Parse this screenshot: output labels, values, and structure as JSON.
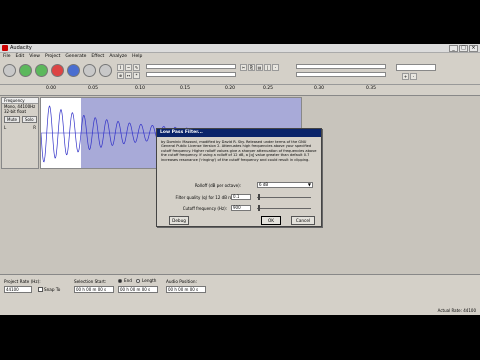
{
  "window": {
    "title": "Audacity"
  },
  "menu": [
    "File",
    "Edit",
    "View",
    "Project",
    "Generate",
    "Effect",
    "Analyze",
    "Help"
  ],
  "ruler": {
    "ticks": [
      "0.00",
      "0.05",
      "0.10",
      "0.15",
      "0.20",
      "0.25",
      "0.30",
      "0.35"
    ]
  },
  "track": {
    "name": "Frequency",
    "info1": "Mono, 44100Hz",
    "info2": "32-bit float",
    "mute": "Mute",
    "solo": "Solo",
    "l": "L",
    "r": "R"
  },
  "dialog": {
    "title": "Low Pass Filter...",
    "description": "by Dominic Mazzoni, modified by David R. Sky. Released under terms of the GNU General Public License Version 2. Attenuates high frequencies above your specified cutoff frequency. Higher rolloff values give a sharper attenuation of frequencies above the cutoff frequency. If using a rolloff of 12 dB, a [q] value greater than default 0.7 increases resonance ('ringing') of the cutoff frequency and could result in clipping.",
    "rolloff_label": "Rolloff (dB per octave):",
    "rolloff_value": "6 dB",
    "q_label": "Filter quality (q) for 12 dB rolloff:",
    "q_value": "0.1",
    "cutoff_label": "Cutoff frequency (Hz):",
    "cutoff_value": "900",
    "debug": "Debug",
    "ok": "OK",
    "cancel": "Cancel"
  },
  "bottom": {
    "project_rate_label": "Project Rate (Hz):",
    "project_rate_value": "44100",
    "snap_label": "Snap To",
    "selection_start_label": "Selection Start:",
    "selection_start_value": "00 h 00 m 00 s",
    "end_label": "End",
    "length_label": "Length",
    "end_value": "00 h 00 m 00 s",
    "audio_position_label": "Audio Position:",
    "audio_position_value": "00 h 00 m 00 s",
    "status": "Actual Rate: 44100"
  },
  "colors": {
    "waveform": "#3232c8",
    "selection": "#a8aad8",
    "dialog_title": "#0a246a"
  }
}
